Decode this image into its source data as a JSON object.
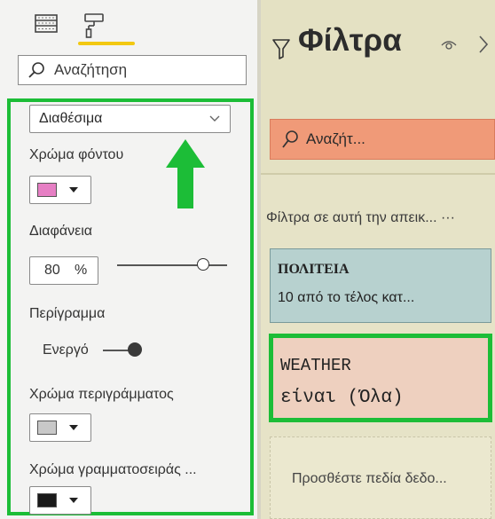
{
  "format_pane": {
    "search_placeholder": "Αναζήτηση",
    "dropdown_value": "Διαθέσιμα",
    "background_color_label": "Χρώμα φόντου",
    "background_color": "#e67fc4",
    "transparency_label": "Διαφάνεια",
    "transparency_value": "80",
    "transparency_unit": "%",
    "border_label": "Περίγραμμα",
    "border_toggle_label": "Ενεργό",
    "border_toggle_on": true,
    "border_color_label": "Χρώμα περιγράμματος",
    "border_color": "#c8c8c8",
    "font_color_label": "Χρώμα γραμματοσειράς ...",
    "font_color": "#1a1a1a"
  },
  "filter_pane": {
    "title": "Φίλτρα",
    "search_placeholder": "Αναζήτ...",
    "section_label": "Φίλτρα σε αυτή την απεικ... ···",
    "cards": [
      {
        "title": "ΠΟΛΙΤΕΙΑ",
        "subtitle": "10 από το τέλος κατ..."
      },
      {
        "title": "WEATHER",
        "subtitle": "είναι (Όλα)"
      }
    ],
    "dropzone_text": "Προσθέστε πεδία δεδο..."
  },
  "colors": {
    "highlight_green": "#1cbd37",
    "active_tab_underline": "#f2c811",
    "filter_pane_bg": "#e6e3c7",
    "search_accent": "#f09a78",
    "state_card_bg": "#b7d1cf",
    "weather_card_bg": "#eed0bf"
  },
  "icons": [
    "fields-icon",
    "format-paint-roller-icon",
    "search-icon",
    "chevron-down-icon",
    "up-arrow-icon",
    "filter-funnel-icon",
    "eye-icon",
    "chevron-right-icon"
  ]
}
